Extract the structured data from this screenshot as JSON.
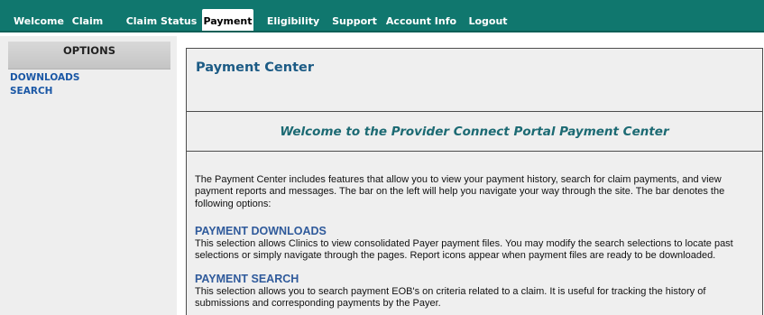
{
  "nav": {
    "items": [
      {
        "label": "Welcome"
      },
      {
        "label": "Claim"
      },
      {
        "label": "Claim Status"
      },
      {
        "label": "Payment",
        "active": true
      },
      {
        "label": "Eligibility"
      },
      {
        "label": "Support"
      },
      {
        "label": "Account Info"
      },
      {
        "label": "Logout"
      }
    ]
  },
  "sidebar": {
    "header": "OPTIONS",
    "links": [
      {
        "label": "DOWNLOADS"
      },
      {
        "label": "SEARCH"
      }
    ]
  },
  "main": {
    "title": "Payment Center",
    "welcome": "Welcome to the Provider Connect Portal Payment Center",
    "intro": "The Payment Center includes features that allow you to view your payment history, search for claim payments, and view payment reports and messages. The bar on the left will help you navigate your way through the site. The bar denotes the following options:",
    "sections": [
      {
        "heading": "PAYMENT DOWNLOADS",
        "text": "This selection allows Clinics to view  consolidated Payer payment files. You may modify the search selections to locate past selections or simply navigate through the pages. Report icons appear when payment files are ready to be downloaded."
      },
      {
        "heading": "PAYMENT SEARCH",
        "text": "This selection allows you to search payment EOB's on criteria related to a claim. It is useful for tracking the history of submissions and corresponding payments by the Payer."
      }
    ]
  },
  "colors": {
    "nav_bg": "#10776e",
    "link": "#1a57a5",
    "title": "#1c5b85",
    "welcome": "#1c6a73",
    "section_heading": "#2f5a9b"
  }
}
